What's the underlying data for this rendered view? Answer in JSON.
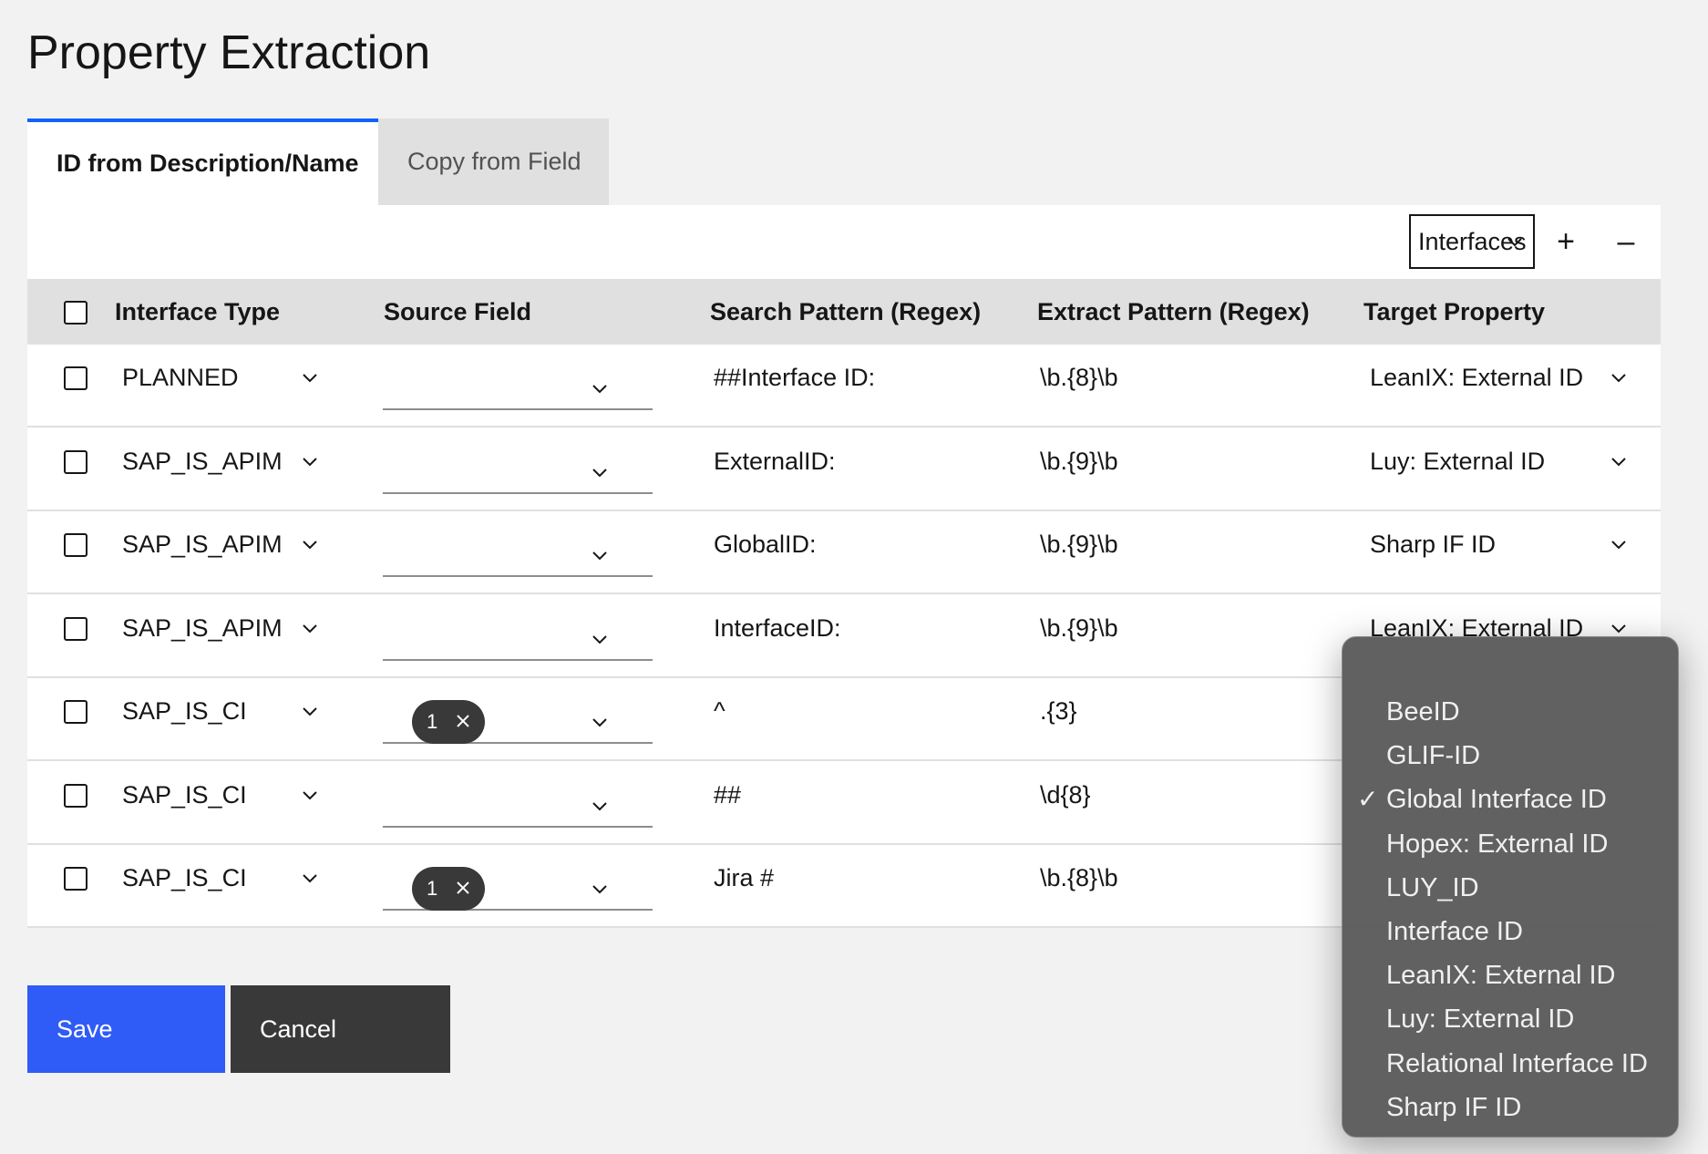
{
  "page": {
    "title": "Property Extraction"
  },
  "tabs": [
    {
      "label": "ID from Description/Name",
      "active": true
    },
    {
      "label": "Copy from Field",
      "active": false
    }
  ],
  "toolbar": {
    "select_value": "Interfaces",
    "add_label": "+",
    "remove_label": "–"
  },
  "table": {
    "headers": {
      "interface_type": "Interface Type",
      "source_field": "Source Field",
      "search_pattern": "Search Pattern (Regex)",
      "extract_pattern": "Extract Pattern (Regex)",
      "target_property": "Target Property"
    },
    "rows": [
      {
        "interface_type": "PLANNED",
        "source_field_tag": "",
        "search_pattern": "##Interface ID:",
        "extract_pattern": "\\b.{8}\\b",
        "target_property": "LeanIX: External ID"
      },
      {
        "interface_type": "SAP_IS_APIM",
        "source_field_tag": "",
        "search_pattern": "ExternalID:",
        "extract_pattern": "\\b.{9}\\b",
        "target_property": "Luy: External ID"
      },
      {
        "interface_type": "SAP_IS_APIM",
        "source_field_tag": "",
        "search_pattern": "GlobalID:",
        "extract_pattern": "\\b.{9}\\b",
        "target_property": "Sharp IF ID"
      },
      {
        "interface_type": "SAP_IS_APIM",
        "source_field_tag": "",
        "search_pattern": "InterfaceID:",
        "extract_pattern": "\\b.{9}\\b",
        "target_property": "LeanIX: External ID"
      },
      {
        "interface_type": "SAP_IS_CI",
        "source_field_tag": "1",
        "search_pattern": "^",
        "extract_pattern": ".{3}",
        "target_property": ""
      },
      {
        "interface_type": "SAP_IS_CI",
        "source_field_tag": "",
        "search_pattern": "##",
        "extract_pattern": "\\d{8}",
        "target_property": ""
      },
      {
        "interface_type": "SAP_IS_CI",
        "source_field_tag": "1",
        "search_pattern": "Jira #",
        "extract_pattern": "\\b.{8}\\b",
        "target_property": ""
      }
    ]
  },
  "buttons": {
    "save": "Save",
    "cancel": "Cancel"
  },
  "dropdown": {
    "selected": "Global Interface ID",
    "options": [
      "BeeID",
      "GLIF-ID",
      "Global Interface ID",
      "Hopex: External ID",
      "LUY_ID",
      "Interface ID",
      "LeanIX: External ID",
      "Luy: External ID",
      "Relational Interface ID",
      "Sharp IF ID"
    ]
  },
  "colors": {
    "accent": "#0f62fe",
    "save_button": "#2f5bf6",
    "cancel_button": "#393939",
    "header_bg": "#e0e0e0",
    "page_bg": "#f2f2f2"
  }
}
